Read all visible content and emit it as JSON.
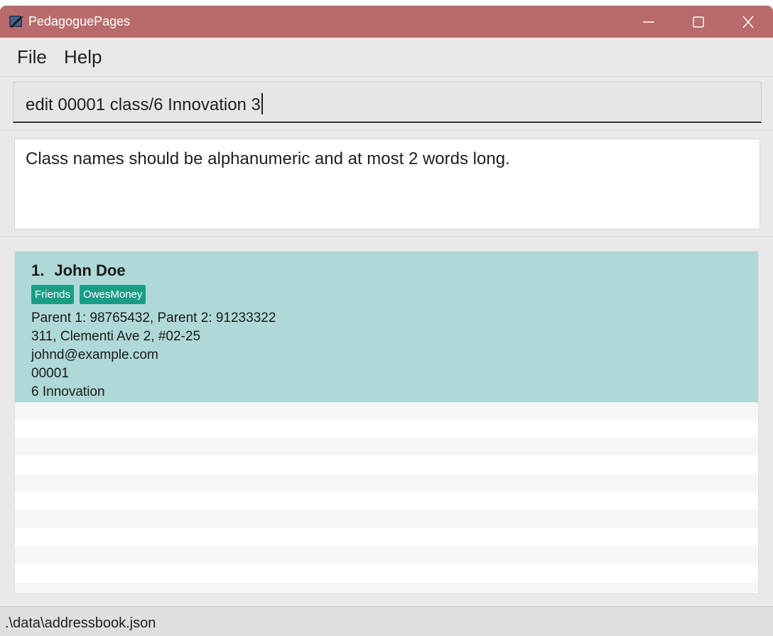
{
  "window": {
    "title": "PedagoguePages",
    "titlebar_color": "#b96b6b"
  },
  "menu": {
    "items": [
      "File",
      "Help"
    ]
  },
  "command": {
    "value": "edit 00001 class/6 Innovation 3"
  },
  "result": {
    "message": "Class names should be alphanumeric and at most 2 words long."
  },
  "persons": [
    {
      "index": "1.",
      "name": "John Doe",
      "tags": [
        "Friends",
        "OwesMoney"
      ],
      "phones": "Parent 1: 98765432, Parent 2: 91233322",
      "address": "311, Clementi Ave 2, #02-25",
      "email": "johnd@example.com",
      "id": "00001",
      "class": "6 Innovation"
    }
  ],
  "status": {
    "path": ".\\data\\addressbook.json"
  },
  "colors": {
    "card_background": "#afd8d8",
    "tag_background": "#199e86"
  },
  "icons": [
    "app-icon",
    "minimize-icon",
    "maximize-icon",
    "close-icon"
  ]
}
